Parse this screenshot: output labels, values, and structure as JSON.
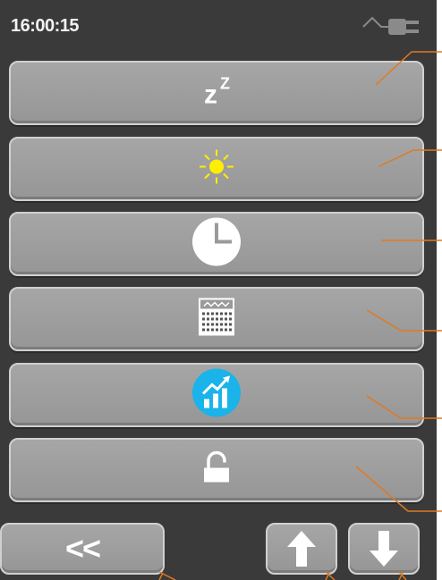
{
  "status_bar": {
    "time": "16:00:15",
    "power_icon": "power-plug-icon"
  },
  "menu": [
    {
      "id": "sleep",
      "icon": "sleep-zz-icon",
      "label": "zZ"
    },
    {
      "id": "brightness",
      "icon": "sun-icon",
      "color": "#ffee00"
    },
    {
      "id": "time",
      "icon": "clock-icon"
    },
    {
      "id": "calendar",
      "icon": "calendar-icon"
    },
    {
      "id": "statistics",
      "icon": "chart-trend-icon",
      "color": "#1ab3ea"
    },
    {
      "id": "lock",
      "icon": "padlock-open-icon"
    }
  ],
  "footer": {
    "back_label": "<<",
    "up_icon": "arrow-up-icon",
    "down_icon": "arrow-down-icon"
  },
  "colors": {
    "screen_background": "#3a3a3a",
    "button_face": "#9e9e9e",
    "callout_line": "#e07a20"
  }
}
